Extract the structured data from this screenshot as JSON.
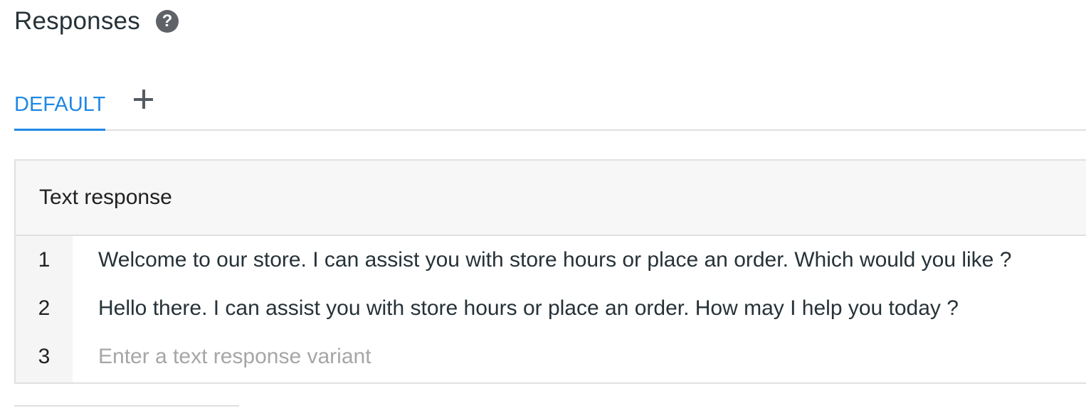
{
  "section": {
    "title": "Responses",
    "help_icon": "question-circle-icon"
  },
  "tabs": {
    "default_label": "DEFAULT",
    "add_icon": "plus-icon",
    "active_color": "#1e88e5"
  },
  "text_response": {
    "header": "Text response",
    "rows": [
      {
        "number": "1",
        "text": "Welcome to our store. I can assist you with store hours or place an order. Which would you like ?"
      },
      {
        "number": "2",
        "text": "Hello there. I can assist you with store hours or place an order. How may I help you today ?"
      },
      {
        "number": "3",
        "placeholder": "Enter a text response variant",
        "value": ""
      }
    ]
  }
}
